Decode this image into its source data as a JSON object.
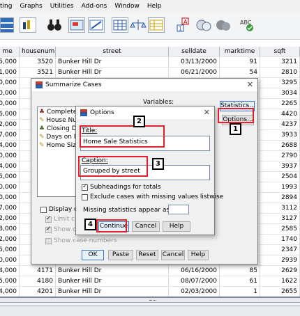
{
  "menu": [
    "ting",
    "Graphs",
    "Utilities",
    "Add-ons",
    "Window",
    "Help"
  ],
  "grid": {
    "headers": [
      "me",
      "housenum",
      "street",
      "selldate",
      "marktime",
      "sqft"
    ],
    "rows": [
      [
        "5,000",
        "3520",
        "Bunker Hill Dr",
        "03/13/2000",
        "91",
        "3211"
      ],
      [
        "1,000",
        "3521",
        "Bunker Hill Dr",
        "06/21/2000",
        "54",
        "2810"
      ],
      [
        "0,000",
        "",
        "",
        "",
        "",
        "3295"
      ],
      [
        "0,000",
        "",
        "",
        "",
        "",
        "3034"
      ],
      [
        "0,000",
        "",
        "",
        "",
        "",
        "2265"
      ],
      [
        "6,000",
        "",
        "",
        "",
        "",
        "4420"
      ],
      [
        "2,000",
        "",
        "",
        "",
        "",
        "4237"
      ],
      [
        "7,000",
        "",
        "",
        "",
        "",
        "3933"
      ],
      [
        "4,000",
        "",
        "",
        "",
        "",
        "2688"
      ],
      [
        "0,000",
        "",
        "",
        "",
        "",
        "2790"
      ],
      [
        "4,000",
        "",
        "",
        "",
        "",
        "3937"
      ],
      [
        "5,000",
        "",
        "",
        "",
        "",
        "2504"
      ],
      [
        "0,000",
        "",
        "",
        "",
        "",
        "1993"
      ],
      [
        "0,000",
        "",
        "",
        "",
        "",
        "2894"
      ],
      [
        "7,000",
        "",
        "",
        "",
        "",
        "3112"
      ],
      [
        "2,000",
        "",
        "",
        "",
        "",
        "3127"
      ],
      [
        "8,000",
        "",
        "",
        "",
        "",
        "2585"
      ],
      [
        "2,000",
        "",
        "",
        "",
        "",
        "1740"
      ],
      [
        "5,000",
        "",
        "",
        "",
        "",
        "2347"
      ],
      [
        "0,000",
        "",
        "",
        "",
        "",
        "2939"
      ],
      [
        "4,000",
        "4171",
        "Bunker Hill Dr",
        "06/16/2000",
        "85",
        "2629"
      ],
      [
        "5,000",
        "4180",
        "Bunker Hill Dr",
        "08/07/2000",
        "61",
        "1622"
      ],
      [
        "4,000",
        "4201",
        "Bunker Hill Dr",
        "02/03/2000",
        "1",
        "2655"
      ]
    ]
  },
  "summarize": {
    "title": "Summarize Cases",
    "variables_label": "Variables:",
    "list": [
      "Complete",
      "House Nu",
      "Closing D",
      "Days on M",
      "Home Siz"
    ],
    "statistics_btn": "Statistics...",
    "options_btn": "Options...",
    "display_label": "Display ca",
    "limit_label": "Limit ca",
    "show_label": "Show o",
    "show_case_numbers": "Show case numbers",
    "ok": "OK",
    "paste": "Paste",
    "reset": "Reset",
    "cancel": "Cancel",
    "help": "Help"
  },
  "options": {
    "title": "Options",
    "title_label": "Title:",
    "title_value": "Home Sale Statistics",
    "caption_label": "Caption:",
    "caption_value": "Grouped by street",
    "subheadings_label": "Subheadings for totals",
    "subheadings_checked": true,
    "exclude_label": "Exclude cases with missing values listwise",
    "exclude_checked": false,
    "missing_label": "Missing statistics appear as:",
    "missing_value": "",
    "continue": "Continue",
    "cancel": "Cancel",
    "help": "Help"
  },
  "callouts": [
    "1",
    "2",
    "3",
    "4"
  ]
}
